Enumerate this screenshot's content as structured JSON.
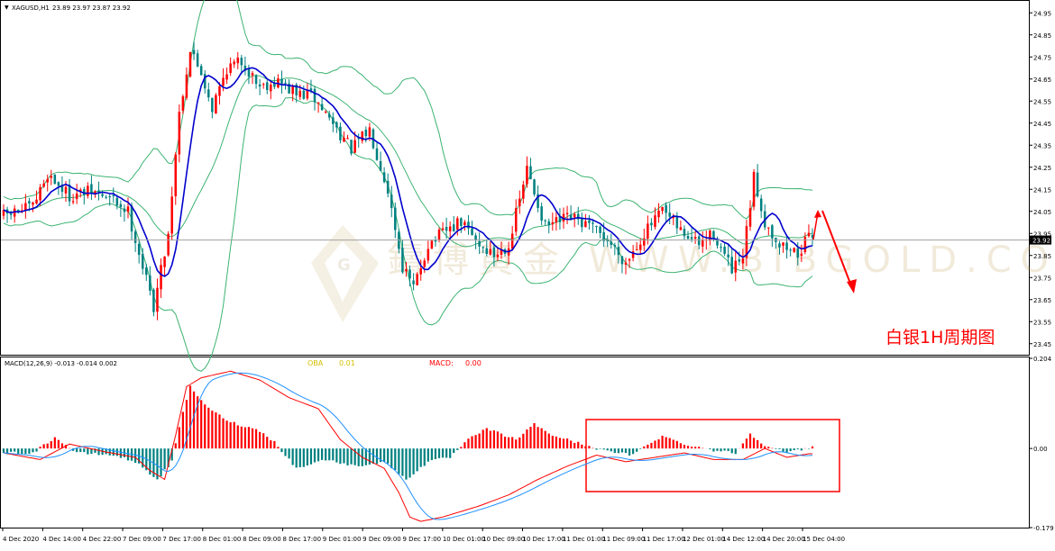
{
  "chart_data": [
    {
      "type": "candlestick",
      "symbol_label": "XAGUSD,H1",
      "ohlc_header": "23.89 23.97 23.87 23.92",
      "current_price_label": "23.92",
      "current_price": 23.92,
      "y_ticks": [
        24.95,
        24.85,
        24.75,
        24.65,
        24.55,
        24.45,
        24.35,
        24.25,
        24.15,
        24.05,
        23.95,
        23.85,
        23.75,
        23.65,
        23.55,
        23.45
      ],
      "ylim": [
        23.4,
        25.0
      ],
      "x_tick_labels": [
        "4 Dec 2020",
        "4 Dec 14:00",
        "4 Dec 22:00",
        "7 Dec 09:00",
        "7 Dec 17:00",
        "8 Dec 01:00",
        "8 Dec 09:00",
        "8 Dec 17:00",
        "9 Dec 01:00",
        "9 Dec 09:00",
        "9 Dec 17:00",
        "10 Dec 01:00",
        "10 Dec 09:00",
        "10 Dec 17:00",
        "11 Dec 01:00",
        "11 Dec 09:00",
        "11 Dec 17:00",
        "12 Dec 01:00",
        "14 Dec 12:00",
        "14 Dec 20:00",
        "15 Dec 04:00"
      ],
      "ma_color": "#0000cd",
      "bollinger_color": "#3cb371",
      "up_color": "#ff0000",
      "down_color": "#008080",
      "trend_waypoints": [
        [
          0,
          24.03
        ],
        [
          8,
          24.07
        ],
        [
          12,
          24.22
        ],
        [
          18,
          24.12
        ],
        [
          24,
          24.14
        ],
        [
          30,
          24.1
        ],
        [
          34,
          24.05
        ],
        [
          38,
          23.8
        ],
        [
          41,
          23.62
        ],
        [
          45,
          23.95
        ],
        [
          48,
          24.5
        ],
        [
          51,
          24.78
        ],
        [
          54,
          24.68
        ],
        [
          57,
          24.52
        ],
        [
          61,
          24.7
        ],
        [
          65,
          24.73
        ],
        [
          70,
          24.62
        ],
        [
          75,
          24.64
        ],
        [
          80,
          24.58
        ],
        [
          84,
          24.58
        ],
        [
          90,
          24.45
        ],
        [
          95,
          24.33
        ],
        [
          100,
          24.42
        ],
        [
          105,
          24.15
        ],
        [
          109,
          23.8
        ],
        [
          112,
          23.7
        ],
        [
          116,
          23.9
        ],
        [
          120,
          23.95
        ],
        [
          125,
          24.0
        ],
        [
          130,
          23.9
        ],
        [
          134,
          23.85
        ],
        [
          138,
          23.9
        ],
        [
          143,
          24.24
        ],
        [
          148,
          23.98
        ],
        [
          155,
          24.02
        ],
        [
          160,
          23.98
        ],
        [
          165,
          23.92
        ],
        [
          170,
          23.82
        ],
        [
          175,
          23.95
        ],
        [
          180,
          24.05
        ],
        [
          185,
          23.96
        ],
        [
          190,
          23.9
        ],
        [
          194,
          23.95
        ],
        [
          199,
          23.78
        ],
        [
          202,
          23.83
        ],
        [
          205,
          24.2
        ],
        [
          208,
          24.0
        ],
        [
          212,
          23.9
        ],
        [
          217,
          23.86
        ],
        [
          221,
          23.95
        ]
      ],
      "annotation_text": "白银1H周期图",
      "annotation_color": "#ff0000",
      "watermark_text": "鑄博黄金  WWW.BIBGOLD.COM"
    },
    {
      "type": "macd",
      "title": "MACD(12,26,9) -0.013 -0.014 0.002",
      "legend": [
        {
          "label": "OBA",
          "value": "0.01",
          "color": "#d4c000"
        },
        {
          "label": "MACD:",
          "value": "0.00",
          "color": "#ff0000"
        }
      ],
      "y_ticks": [
        "0.204",
        "0.00",
        "-0.179"
      ],
      "ylim": [
        -0.179,
        0.204
      ],
      "hist_pos_color": "#ff0000",
      "hist_neg_color": "#008080",
      "macd_color": "#ff0000",
      "signal_color": "#1e90ff",
      "macd_waypoints": [
        [
          0,
          -0.01
        ],
        [
          10,
          -0.025
        ],
        [
          18,
          0.01
        ],
        [
          28,
          -0.008
        ],
        [
          36,
          -0.02
        ],
        [
          40,
          -0.05
        ],
        [
          44,
          -0.07
        ],
        [
          47,
          0.03
        ],
        [
          50,
          0.14
        ],
        [
          54,
          0.16
        ],
        [
          62,
          0.175
        ],
        [
          70,
          0.155
        ],
        [
          78,
          0.115
        ],
        [
          86,
          0.09
        ],
        [
          92,
          0.02
        ],
        [
          98,
          -0.02
        ],
        [
          104,
          -0.045
        ],
        [
          108,
          -0.1
        ],
        [
          111,
          -0.155
        ],
        [
          114,
          -0.165
        ],
        [
          120,
          -0.155
        ],
        [
          130,
          -0.13
        ],
        [
          138,
          -0.105
        ],
        [
          146,
          -0.07
        ],
        [
          154,
          -0.04
        ],
        [
          162,
          -0.015
        ],
        [
          170,
          -0.03
        ],
        [
          178,
          -0.02
        ],
        [
          186,
          -0.01
        ],
        [
          194,
          -0.025
        ],
        [
          202,
          -0.025
        ],
        [
          208,
          0.0
        ],
        [
          214,
          -0.02
        ],
        [
          220,
          -0.012
        ]
      ],
      "signal_lag": 7,
      "histogram_waypoints": [
        [
          0,
          -0.01
        ],
        [
          8,
          -0.01
        ],
        [
          14,
          0.025
        ],
        [
          20,
          -0.01
        ],
        [
          30,
          -0.015
        ],
        [
          36,
          -0.03
        ],
        [
          42,
          -0.07
        ],
        [
          46,
          -0.03
        ],
        [
          48,
          0.05
        ],
        [
          51,
          0.14
        ],
        [
          56,
          0.09
        ],
        [
          62,
          0.06
        ],
        [
          70,
          0.04
        ],
        [
          74,
          0.015
        ],
        [
          80,
          -0.045
        ],
        [
          88,
          -0.025
        ],
        [
          96,
          -0.04
        ],
        [
          104,
          -0.03
        ],
        [
          110,
          -0.07
        ],
        [
          116,
          -0.03
        ],
        [
          122,
          -0.02
        ],
        [
          127,
          0.02
        ],
        [
          132,
          0.045
        ],
        [
          140,
          0.02
        ],
        [
          145,
          0.055
        ],
        [
          150,
          0.03
        ],
        [
          158,
          0.01
        ],
        [
          164,
          -0.005
        ],
        [
          172,
          -0.015
        ],
        [
          176,
          0.01
        ],
        [
          180,
          0.028
        ],
        [
          186,
          0.01
        ],
        [
          194,
          -0.004
        ],
        [
          200,
          -0.01
        ],
        [
          204,
          0.033
        ],
        [
          208,
          0.008
        ],
        [
          214,
          -0.01
        ],
        [
          221,
          0.003
        ]
      ]
    }
  ]
}
